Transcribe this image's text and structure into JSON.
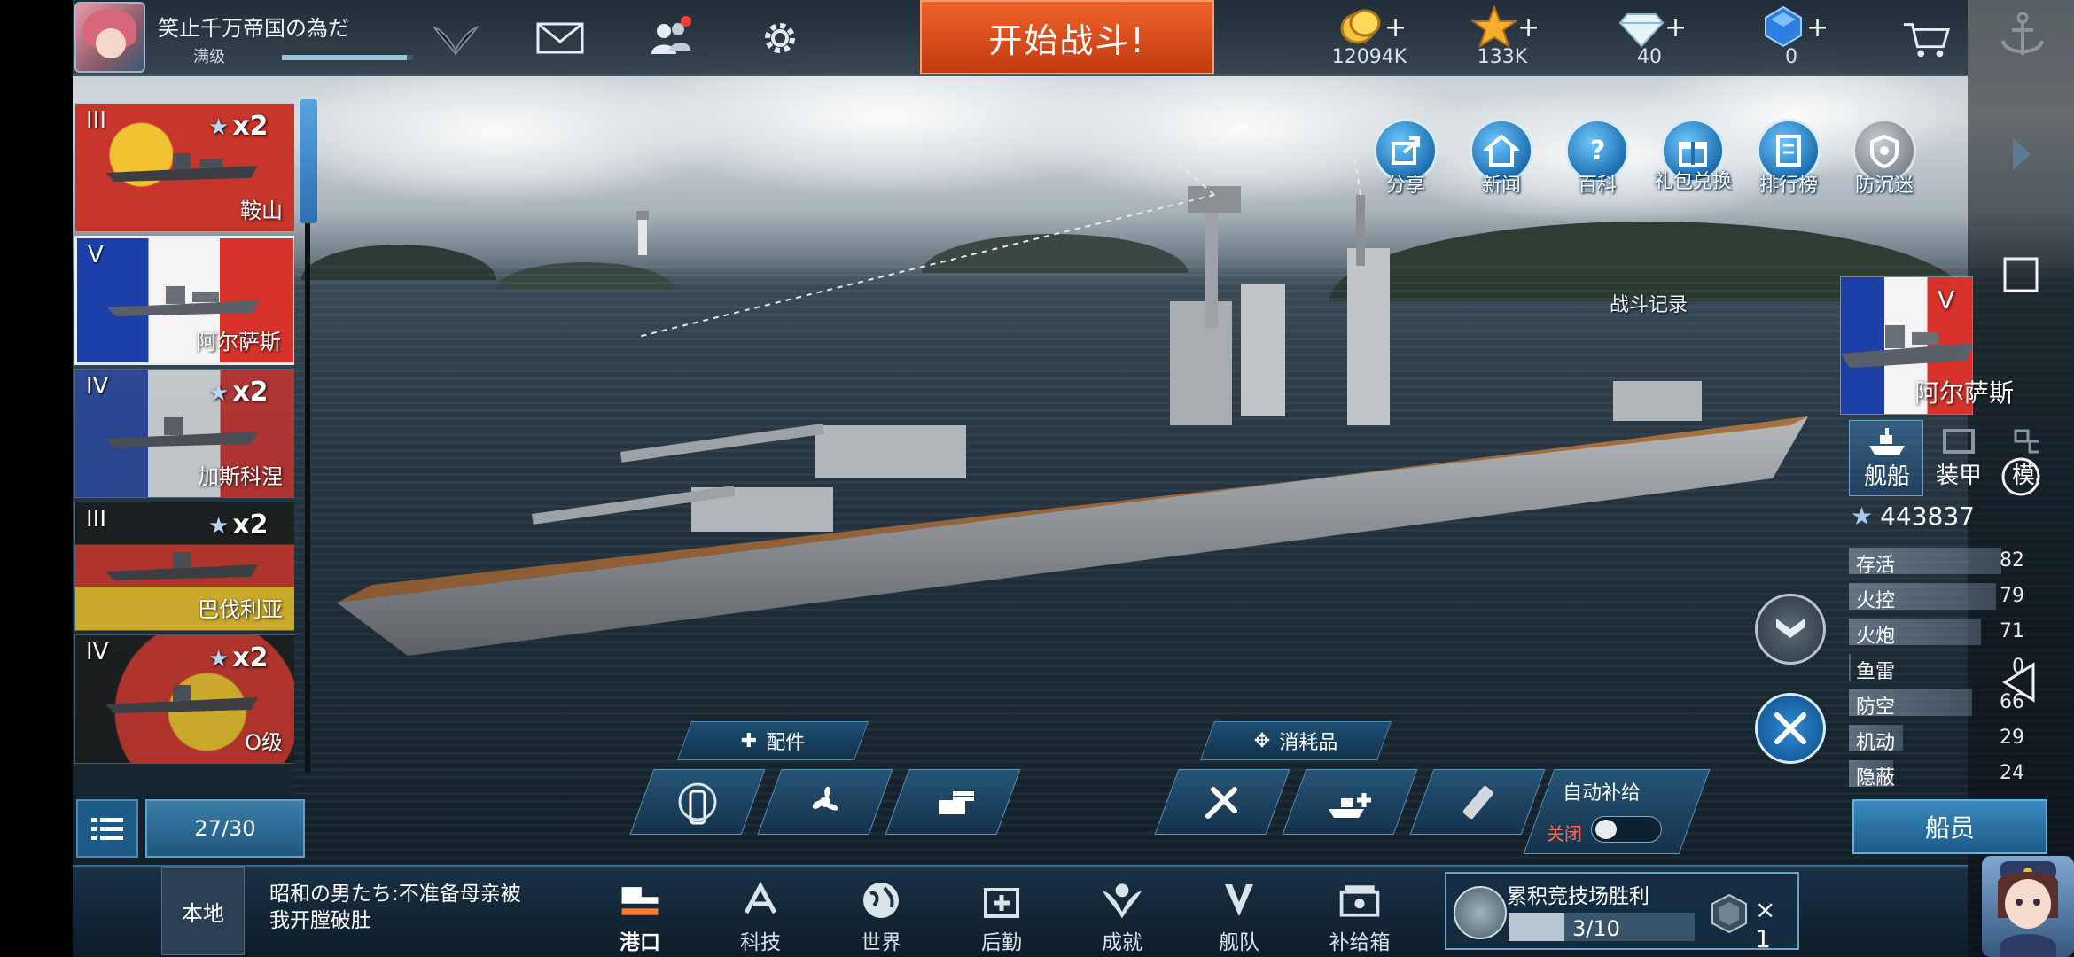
{
  "player": {
    "name": "笑止千万帝国の為だ",
    "level_label": "满级",
    "exp_fraction": 0.95
  },
  "header": {
    "battle_button": "开始战斗!",
    "currencies": [
      {
        "icon": "gold-coin-icon",
        "value": "12094K"
      },
      {
        "icon": "star-icon",
        "value": "133K"
      },
      {
        "icon": "diamond-icon",
        "value": "40"
      },
      {
        "icon": "blue-crystal-icon",
        "value": "0"
      }
    ]
  },
  "ships": [
    {
      "tier": "III",
      "count": "x2",
      "name": "鞍山",
      "flag_colors": [
        "#c8352a",
        "#f1c232"
      ]
    },
    {
      "tier": "V",
      "count": "",
      "name": "阿尔萨斯",
      "flag_colors": [
        "#1d3fa8",
        "#f4f4f4",
        "#d9322b"
      ],
      "selected": true
    },
    {
      "tier": "IV",
      "count": "x2",
      "name": "加斯科涅",
      "flag_colors": [
        "#2a4aa8",
        "#f4f4f4",
        "#d9322b"
      ]
    },
    {
      "tier": "III",
      "count": "x2",
      "name": "巴伐利亚",
      "flag_colors": [
        "#1b1b1b",
        "#c8352a",
        "#e8c02a"
      ]
    },
    {
      "tier": "IV",
      "count": "x2",
      "name": "O级",
      "flag_colors": [
        "#1b1b1b",
        "#c8352a",
        "#e8c02a"
      ]
    }
  ],
  "dock_count": "27/30",
  "features": [
    {
      "label": "分享",
      "icon": "share-icon"
    },
    {
      "label": "新闻",
      "icon": "news-icon"
    },
    {
      "label": "百科",
      "icon": "encyclopedia-icon"
    },
    {
      "label": "礼包兑换",
      "icon": "gift-code-icon"
    },
    {
      "label": "排行榜",
      "icon": "leaderboard-icon"
    },
    {
      "label": "防沉迷",
      "icon": "anti-addiction-icon"
    }
  ],
  "battle_record": "战斗记录",
  "selected_ship": {
    "name": "阿尔萨斯",
    "tier": "V",
    "tabs": [
      "舰船",
      "装甲",
      "模块"
    ],
    "power": "443837",
    "stats": [
      {
        "name": "存活",
        "value": 82
      },
      {
        "name": "火控",
        "value": 79
      },
      {
        "name": "火炮",
        "value": 71
      },
      {
        "name": "鱼雷",
        "value": 0
      },
      {
        "name": "防空",
        "value": 66
      },
      {
        "name": "机动",
        "value": 29
      },
      {
        "name": "隐蔽",
        "value": 24
      }
    ],
    "crew_button": "船员"
  },
  "equipment": {
    "parts_label": "配件",
    "consumables_label": "消耗品",
    "auto_supply_label": "自动补给",
    "auto_supply_state": "关闭"
  },
  "chat": {
    "channel": "本地",
    "message": "昭和の男たち:不准备母亲被我开膛破肚"
  },
  "nav": [
    {
      "label": "港口",
      "icon": "port-icon",
      "active": true
    },
    {
      "label": "科技",
      "icon": "tech-icon"
    },
    {
      "label": "世界",
      "icon": "world-icon"
    },
    {
      "label": "后勤",
      "icon": "logistics-icon"
    },
    {
      "label": "成就",
      "icon": "achievement-icon"
    },
    {
      "label": "舰队",
      "icon": "fleet-icon"
    },
    {
      "label": "补给箱",
      "icon": "supply-box-icon"
    }
  ],
  "mission": {
    "title": "累积竞技场胜利",
    "progress_text": "3/10",
    "progress_fraction": 0.3,
    "reward_count": "× 1"
  }
}
